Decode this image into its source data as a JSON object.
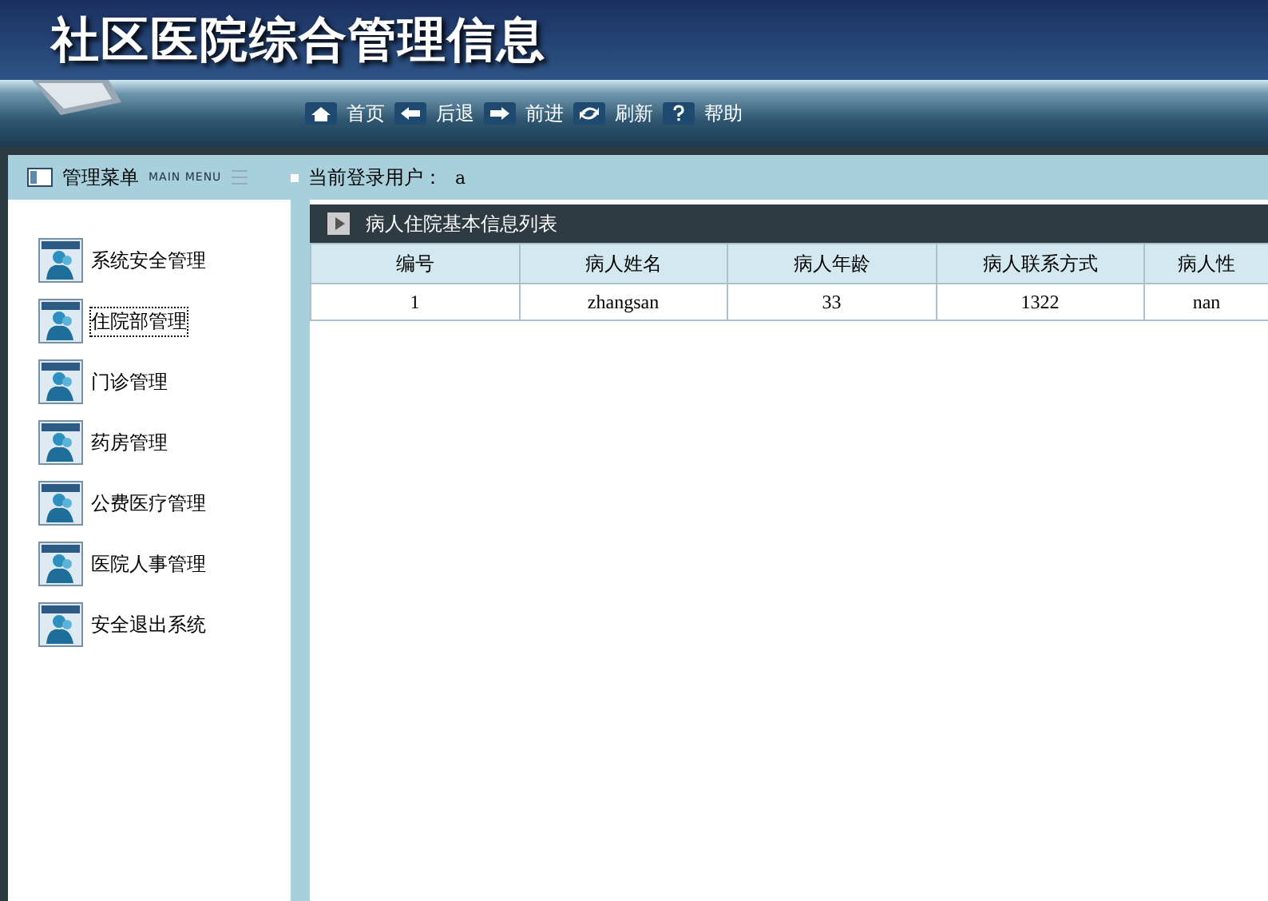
{
  "header": {
    "title": "社区医院综合管理信息"
  },
  "nav": [
    {
      "kind": "home",
      "label": "首页"
    },
    {
      "kind": "back",
      "label": "后退"
    },
    {
      "kind": "forward",
      "label": "前进"
    },
    {
      "kind": "refresh",
      "label": "刷新"
    },
    {
      "kind": "help",
      "label": "帮助"
    }
  ],
  "sidebar": {
    "title": "管理菜单",
    "subtitle": "MAIN MENU",
    "items": [
      {
        "label": "系统安全管理",
        "selected": false
      },
      {
        "label": "住院部管理",
        "selected": true
      },
      {
        "label": "门诊管理",
        "selected": false
      },
      {
        "label": "药房管理",
        "selected": false
      },
      {
        "label": "公费医疗管理",
        "selected": false
      },
      {
        "label": "医院人事管理",
        "selected": false
      },
      {
        "label": "安全退出系统",
        "selected": false
      }
    ]
  },
  "user_bar": {
    "label": "当前登录用户：",
    "user": "a"
  },
  "table": {
    "title": "病人住院基本信息列表",
    "columns": [
      "编号",
      "病人姓名",
      "病人年龄",
      "病人联系方式",
      "病人性"
    ],
    "rows": [
      [
        "1",
        "zhangsan",
        "33",
        "1322",
        "nan"
      ]
    ]
  }
}
